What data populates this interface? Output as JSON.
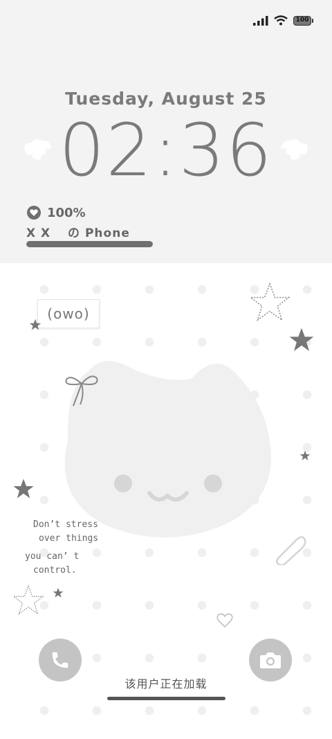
{
  "status_bar": {
    "signal_icon": "signal-icon",
    "wifi_icon": "wifi-icon",
    "battery_level": "100"
  },
  "lock_screen": {
    "date": "Tuesday, August 25",
    "time": "02:36",
    "battery_percent": "100%",
    "battery_fill_fraction": 1.0,
    "device_name": "X X　 の Phone"
  },
  "wallpaper": {
    "emoticon": "(owo)",
    "quote_lines": [
      "Don’t stress",
      "over things",
      "you can’ t",
      "control."
    ]
  },
  "bottom": {
    "phone_button_icon": "phone-icon",
    "camera_button_icon": "camera-icon",
    "loading_text": "该用户正在加载"
  },
  "colors": {
    "top_panel": "#f3f3f3",
    "text": "#7a7a7a",
    "dots": "#efefef",
    "button": "#c4c4c4"
  }
}
